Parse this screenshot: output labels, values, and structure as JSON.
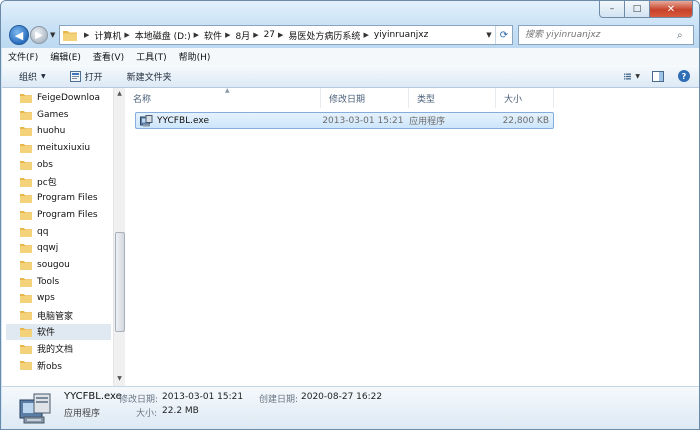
{
  "window": {
    "minimize": "–",
    "maximize": "□",
    "close": "✕"
  },
  "address": {
    "crumbs": [
      "计算机",
      "本地磁盘 (D:)",
      "软件",
      "8月",
      "27",
      "易医处方病历系统",
      "yiyinruanjxz"
    ]
  },
  "search": {
    "placeholder": "搜索 yiyinruanjxz"
  },
  "menu": [
    "文件(F)",
    "编辑(E)",
    "查看(V)",
    "工具(T)",
    "帮助(H)"
  ],
  "toolbar": {
    "organize": "组织",
    "open": "打开",
    "new_folder": "新建文件夹"
  },
  "nav_pane": {
    "items": [
      "FeigeDownloa",
      "Games",
      "huohu",
      "meituxiuxiu",
      "obs",
      "pc包",
      "Program Files",
      "Program Files",
      "qq",
      "qqwj",
      "sougou",
      "Tools",
      "wps",
      "电脑管家",
      "软件",
      "我的文档",
      "新obs"
    ],
    "selected_index": 14
  },
  "columns": [
    "名称",
    "修改日期",
    "类型",
    "大小"
  ],
  "files": [
    {
      "name": "YYCFBL.exe",
      "modified": "2013-03-01 15:21",
      "type": "应用程序",
      "size": "22,800 KB"
    }
  ],
  "details": {
    "name": "YYCFBL.exe",
    "type": "应用程序",
    "modified_label": "修改日期:",
    "modified": "2013-03-01 15:21",
    "created_label": "创建日期:",
    "created": "2020-08-27 16:22",
    "size_label": "大小:",
    "size": "22.2 MB"
  },
  "colors": {
    "frame": "#cfe6f8",
    "selection": "#cde6fb",
    "folder": "#e8b94a"
  }
}
